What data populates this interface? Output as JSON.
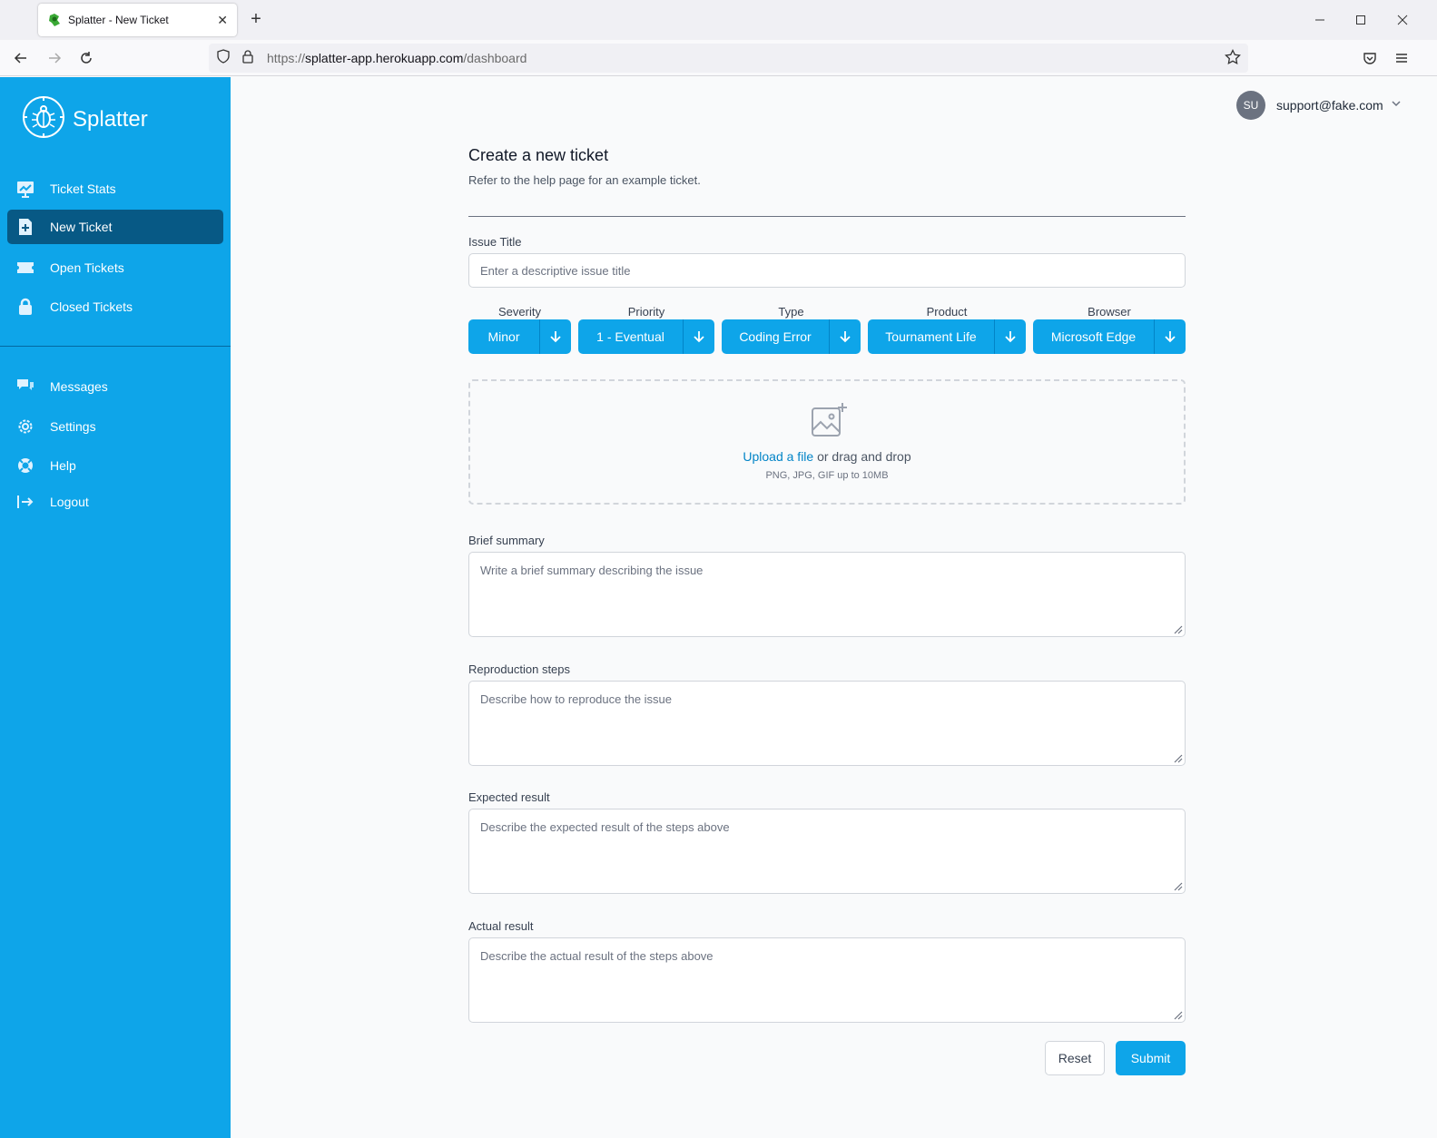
{
  "browser": {
    "tab_title": "Splatter - New Ticket",
    "url_scheme": "https://",
    "url_host": "splatter-app.herokuapp.com",
    "url_path": "/dashboard"
  },
  "app": {
    "name": "Splatter",
    "brand_color": "#0ea5e9",
    "active_color": "#075985"
  },
  "sidebar": {
    "primary": [
      {
        "label": "Ticket Stats",
        "icon": "chart-icon"
      },
      {
        "label": "New Ticket",
        "icon": "plus-document-icon",
        "active": true
      },
      {
        "label": "Open Tickets",
        "icon": "ticket-icon"
      },
      {
        "label": "Closed Tickets",
        "icon": "lock-icon"
      }
    ],
    "secondary": [
      {
        "label": "Messages",
        "icon": "chat-icon"
      },
      {
        "label": "Settings",
        "icon": "gear-icon"
      },
      {
        "label": "Help",
        "icon": "lifebuoy-icon"
      },
      {
        "label": "Logout",
        "icon": "logout-icon"
      }
    ]
  },
  "user": {
    "initials": "SU",
    "email": "support@fake.com"
  },
  "form": {
    "title": "Create a new ticket",
    "subtitle": "Refer to the help page for an example ticket.",
    "issue_title": {
      "label": "Issue Title",
      "placeholder": "Enter a descriptive issue title"
    },
    "selects": [
      {
        "label": "Severity",
        "value": "Minor"
      },
      {
        "label": "Priority",
        "value": "1 - Eventual"
      },
      {
        "label": "Type",
        "value": "Coding Error"
      },
      {
        "label": "Product",
        "value": "Tournament Life"
      },
      {
        "label": "Browser",
        "value": "Microsoft Edge"
      }
    ],
    "upload": {
      "link": "Upload a file",
      "text": " or drag and drop",
      "hint": "PNG, JPG, GIF up to 10MB"
    },
    "summary": {
      "label": "Brief summary",
      "placeholder": "Write a brief summary describing the issue"
    },
    "steps": {
      "label": "Reproduction steps",
      "placeholder": "Describe how to reproduce the issue"
    },
    "expected": {
      "label": "Expected result",
      "placeholder": "Describe the expected result of the steps above"
    },
    "actual": {
      "label": "Actual result",
      "placeholder": "Describe the actual result of the steps above"
    },
    "reset_label": "Reset",
    "submit_label": "Submit"
  }
}
